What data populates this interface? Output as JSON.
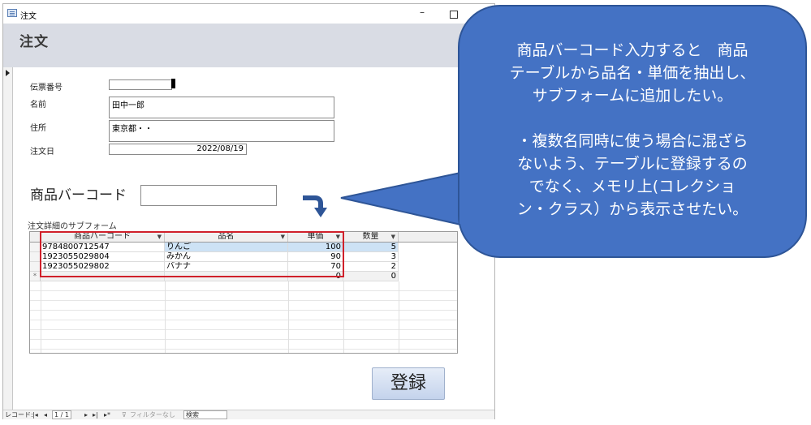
{
  "window": {
    "title": "注文",
    "form_title": "注文"
  },
  "form": {
    "slip_no_label": "伝票番号",
    "name_label": "名前",
    "name_value": "田中一郎",
    "address_label": "住所",
    "address_value": "東京都・・",
    "order_date_label": "注文日",
    "order_date_value": "2022/08/19",
    "barcode_label": "商品バーコード",
    "barcode_value": "",
    "subform_label": "注文詳細のサブフォーム"
  },
  "grid": {
    "columns": [
      "商品バーコード",
      "品名",
      "単価",
      "数量"
    ],
    "rows": [
      {
        "barcode": "9784800712547",
        "name": "りんご",
        "price": "100",
        "qty": "5"
      },
      {
        "barcode": "1923055029804",
        "name": "みかん",
        "price": "90",
        "qty": "3"
      },
      {
        "barcode": "1923055029802",
        "name": "バナナ",
        "price": "70",
        "qty": "2"
      }
    ],
    "new_row": {
      "marker": "*",
      "price": "0",
      "qty": "0"
    }
  },
  "buttons": {
    "save": "登録"
  },
  "navbar": {
    "record_label": "レコード:",
    "position": "1 / 1",
    "filter": "フィルターなし",
    "search": "検索"
  },
  "callout": {
    "line1": "商品バーコード入力すると　商品",
    "line2": "テーブルから品名・単価を抽出し、",
    "line3": "サブフォームに追加したい。",
    "line4": "・複数名同時に使う場合に混ざら",
    "line5": "ないよう、テーブルに登録するの",
    "line6": "でなく、メモリ上(コレクショ",
    "line7": "ン・クラス）から表示させたい。"
  },
  "colors": {
    "callout": "#4472c4",
    "highlight_box": "#d0202a",
    "arrow": "#2e5597"
  }
}
